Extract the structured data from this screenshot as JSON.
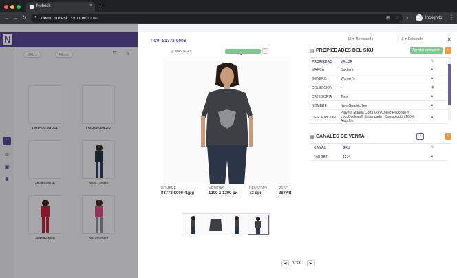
{
  "browser": {
    "tab_title": "Nubesk",
    "tab_close": "×",
    "new_tab": "+",
    "url_host": "demo.nubesk.com.mx",
    "url_path": "/home",
    "profile_label": "Incógnito",
    "nav": {
      "back": "←",
      "forward": "→",
      "reload": "↻"
    }
  },
  "app": {
    "logo": "N",
    "pills": [
      "SKU's",
      "Filtros"
    ],
    "cards": [
      "LMPSN-WG64",
      "LMPSN-WG17",
      "28141-0034",
      "76067-0006",
      "76454-0005",
      "76029-0007"
    ]
  },
  "modal": {
    "pc_code": "PC9: 83773-0006",
    "status_reviewing": "Revisando",
    "status_editing": "Editando",
    "close": "×",
    "master": "MASTER",
    "image_meta": [
      {
        "label": "NOMBRE",
        "value": "83773-0006-4.jpg"
      },
      {
        "label": "MEDIDAS",
        "value": "1200 x 1200 px"
      },
      {
        "label": "DENSIDAD",
        "value": "72 dpi"
      },
      {
        "label": "PESO",
        "value": "387KB"
      }
    ],
    "pager": {
      "prev": "◀",
      "next": "▶",
      "text": "3/33"
    }
  },
  "properties": {
    "title": "PROPIEDADES DEL SKU",
    "approve_label": "Aprobar contenido",
    "col_property": "PROPIEDAD",
    "col_value": "VALOR",
    "rows": [
      {
        "key": "MARCA",
        "value": "Dockers"
      },
      {
        "key": "GENERO",
        "value": "Women's"
      },
      {
        "key": "COLECCION",
        "value": "-"
      },
      {
        "key": "CATEGORIA",
        "value": "Tops"
      },
      {
        "key": "NOMBRE",
        "value": "New Graphic Tee"
      },
      {
        "key": "DESCRIPCION",
        "value": "Playera Manga Corta Con Cuello Redondo Y LogoDockers® Estampado , Composición 100% Algodón"
      }
    ]
  },
  "channels": {
    "title": "CANALES DE VENTA",
    "col_channel": "CANAL",
    "col_sku": "SKU",
    "rows": [
      {
        "channel": "TARGET",
        "sku": "1234"
      }
    ]
  },
  "colors": {
    "accent": "#5b4a9a",
    "approve": "#7ec88e",
    "warning": "#f0963a"
  }
}
